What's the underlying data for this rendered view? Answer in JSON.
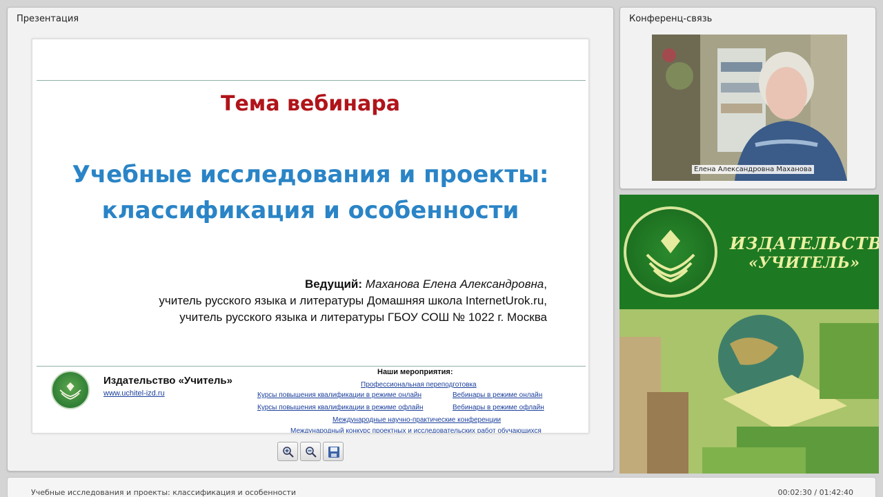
{
  "presentation_panel": {
    "title": "Презентация"
  },
  "slide": {
    "title": "Тема вебинара",
    "subtitle_line1": "Учебные исследования и проекты:",
    "subtitle_line2": "классификация и особенности",
    "host_label": "Ведущий:",
    "host_name": "Маханова Елена Александровна",
    "host_line2": "учитель русского языка и литературы Домашняя школа InternetUrok.ru,",
    "host_line3": "учитель русского языка и литературы ГБОУ СОШ № 1022 г. Москва",
    "footer": {
      "publisher": "Издательство «Учитель»",
      "site": "www.uchitel-izd.ru",
      "events_heading": "Наши мероприятия:",
      "events": [
        "Профессиональная переподготовка",
        "Курсы повышения квалификации в режиме онлайн",
        "Вебинары в режиме онлайн",
        "Курсы повышения квалификации в режиме офлайн",
        "Вебинары в режиме офлайн",
        "Международные научно-практические конференции",
        "Международный конкурс проектных и исследовательских работ обучающихся"
      ]
    }
  },
  "toolbar": {
    "zoom_in": "zoom-in-icon",
    "zoom_out": "zoom-out-icon",
    "save": "save-icon"
  },
  "conference_panel": {
    "title": "Конференц-связь",
    "participant_name": "Елена Александровна Маханова"
  },
  "banner": {
    "line1": "ИЗДАТЕЛЬСТВО",
    "line2": "«УЧИТЕЛЬ»"
  },
  "status_bar": {
    "title": "Учебные исследования и проекты: классификация и особенности",
    "time": "00:02:30 / 01:42:40"
  },
  "colors": {
    "title_red": "#b0141a",
    "subtitle_blue": "#2a84c6",
    "brand_green": "#1d7a22",
    "link_blue": "#1b3f9c"
  }
}
